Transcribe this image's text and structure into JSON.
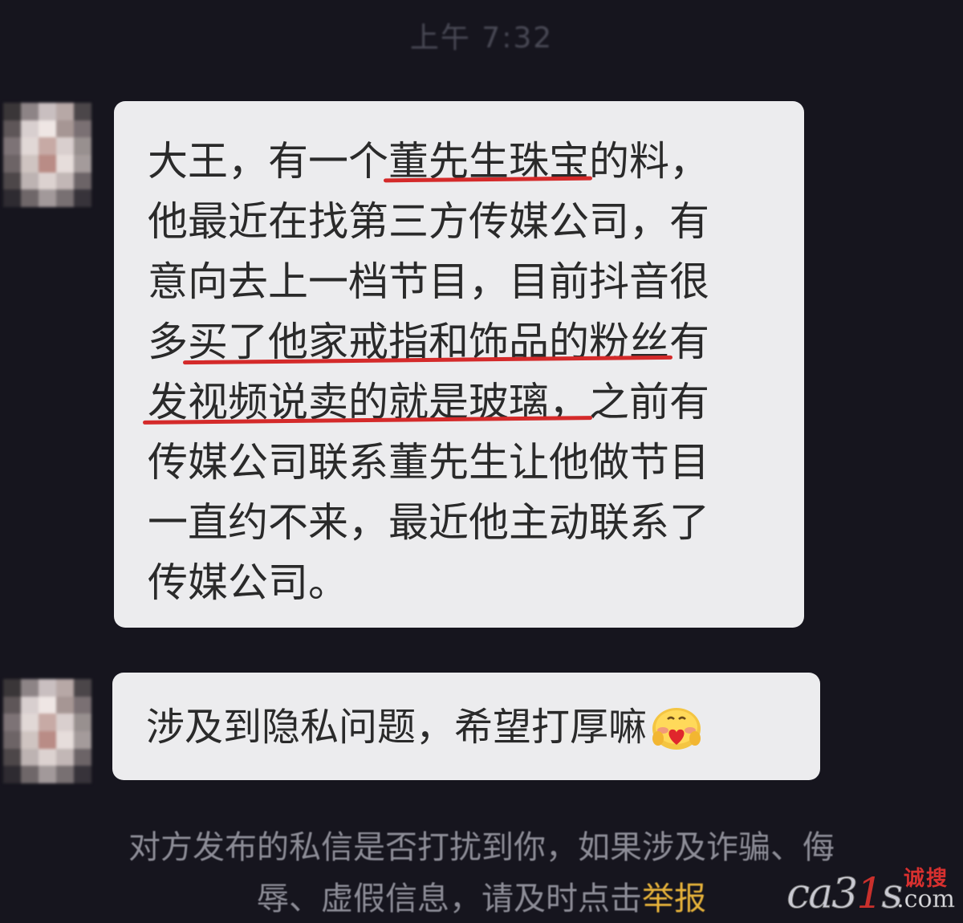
{
  "timestamp": "上午 7:32",
  "messages": [
    {
      "lines": [
        {
          "pre": "大王，有一个",
          "hl": "董先生珠宝",
          "post": "的料，"
        },
        {
          "pre": "他最近在找第三方传媒公司，有",
          "hl": "",
          "post": ""
        },
        {
          "pre": "意向去上一档节目，目前抖音很",
          "hl": "",
          "post": ""
        },
        {
          "pre": "多",
          "hl": "买了他家戒指和饰品的粉丝",
          "post": "有"
        },
        {
          "pre": "",
          "hl": "发视频说卖的就是玻璃，",
          "post": "之前有"
        },
        {
          "pre": "传媒公司联系董先生让他做节目",
          "hl": "",
          "post": ""
        },
        {
          "pre": "一直约不来，最近他主动联系了",
          "hl": "",
          "post": ""
        },
        {
          "pre": "传媒公司。",
          "hl": "",
          "post": ""
        }
      ]
    },
    {
      "text": "涉及到隐私问题，希望打厚嘛",
      "emoji": "blushing-heart-face-icon"
    }
  ],
  "notice": {
    "line1": "对方发布的私信是否打扰到你，如果涉及诈骗、侮",
    "line2_prefix": "辱、虚假信息，请及时点击",
    "report_link": "举报"
  },
  "watermark": {
    "prefix": "ca3",
    "one": "1",
    "suffix": "s",
    "dotcom": ".com",
    "cn": "诚搜"
  },
  "colors": {
    "background": "#16151e",
    "bubble": "#ececee",
    "highlight_underline": "#d42a2a",
    "report_link": "#e6b23a"
  }
}
